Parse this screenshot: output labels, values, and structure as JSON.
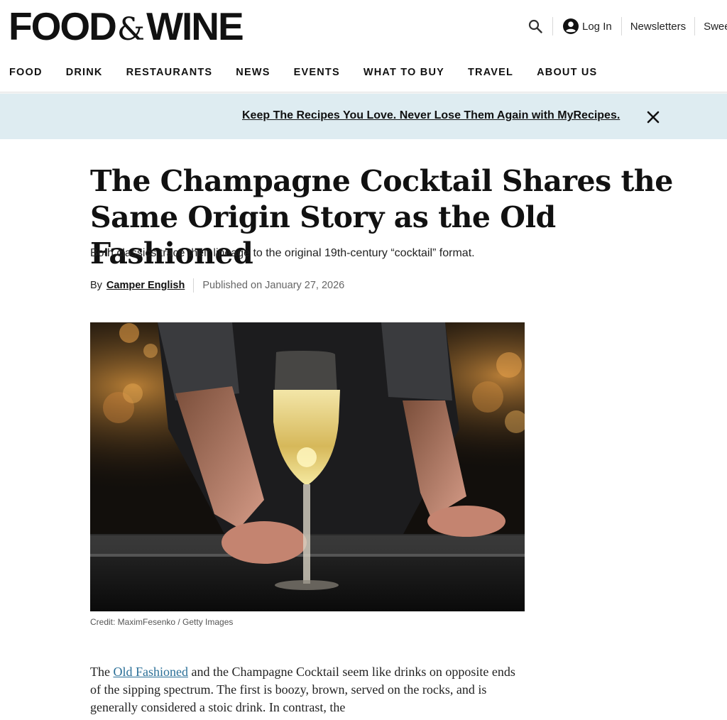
{
  "header": {
    "logo_left": "FOOD",
    "logo_amp": "&",
    "logo_right": "WINE",
    "login_label": "Log In",
    "newsletters_label": "Newsletters",
    "sweeps_label": "Swee",
    "search_icon": "search-icon",
    "account_icon": "account-circle-icon"
  },
  "nav": {
    "items": [
      "FOOD",
      "DRINK",
      "RESTAURANTS",
      "NEWS",
      "EVENTS",
      "WHAT TO BUY",
      "TRAVEL",
      "ABOUT US"
    ]
  },
  "banner": {
    "message": "Keep The Recipes You Love. Never Lose Them Again with MyRecipes.",
    "close_icon": "close-icon",
    "background": "#deecf1"
  },
  "article": {
    "headline": "The Champagne Cocktail Shares the Same Origin Story as the Old Fashioned",
    "dek": "Both classics trace their lineage to the original 19th-century “cocktail” format.",
    "by_label": "By",
    "author": "Camper English",
    "published": "Published on January 27, 2026",
    "image_credit": "Credit: MaximFesenko / Getty Images",
    "body_start": "The ",
    "body_link": "Old Fashioned",
    "body_rest": " and the Champagne Cocktail seem like drinks on opposite ends of the sipping spectrum. The first is boozy, brown, served on the rocks, and is generally considered a stoic drink. In contrast, the",
    "link_color": "#2a6f97"
  }
}
